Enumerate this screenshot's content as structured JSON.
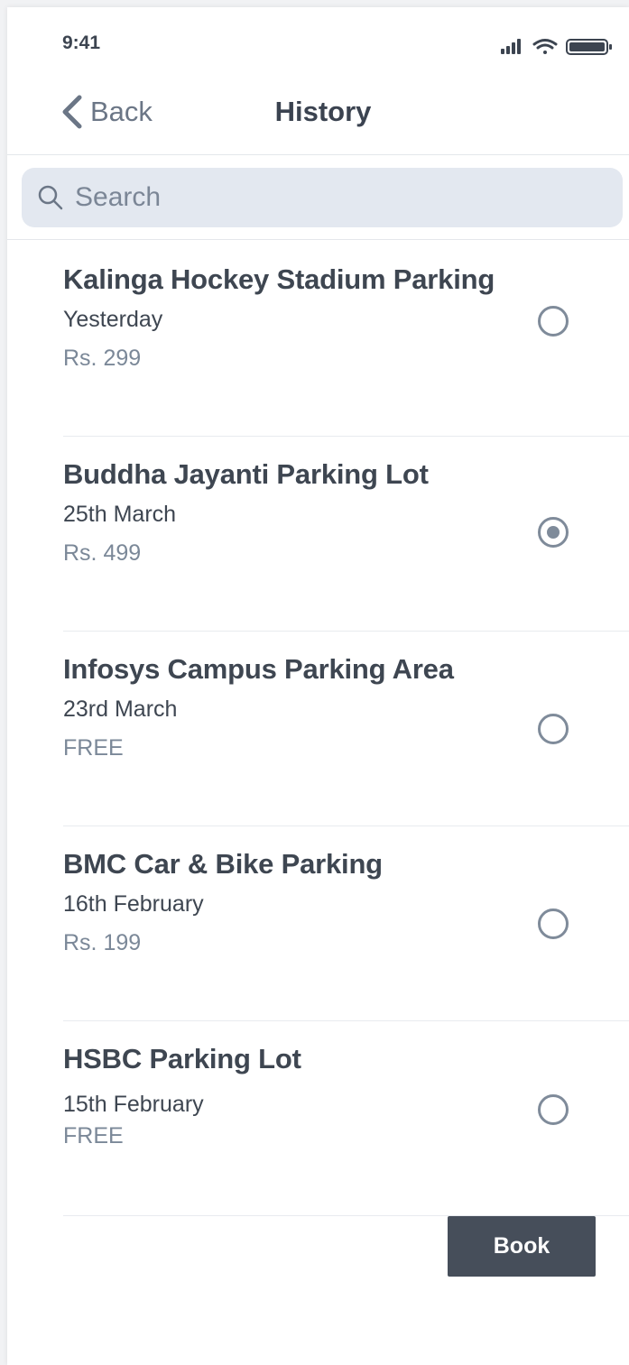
{
  "status_bar": {
    "time": "9:41",
    "icons": [
      "signal-icon",
      "wifi-icon",
      "battery-icon"
    ]
  },
  "header": {
    "back_label": "Back",
    "title": "History"
  },
  "search": {
    "placeholder": "Search",
    "value": ""
  },
  "items": [
    {
      "name": "Kalinga Hockey Stadium Parking",
      "date": "Yesterday",
      "price": "Rs. 299",
      "selected": false
    },
    {
      "name": "Buddha Jayanti Parking Lot",
      "date": "25th March",
      "price": "Rs. 499",
      "selected": true
    },
    {
      "name": "Infosys Campus Parking Area",
      "date": "23rd March",
      "price": "FREE",
      "selected": false
    },
    {
      "name": "BMC Car & Bike Parking",
      "date": "16th February",
      "price": "Rs. 199",
      "selected": false
    },
    {
      "name": "HSBC Parking Lot",
      "date": "15th February",
      "price": "FREE",
      "selected": false
    }
  ],
  "footer": {
    "book_label": "Book"
  },
  "colors": {
    "primary_text": "#3e4651",
    "secondary_text": "#7b8898",
    "search_bg": "#e3e8f0",
    "button_bg": "#464e5a",
    "radio": "#7f8b9a"
  }
}
